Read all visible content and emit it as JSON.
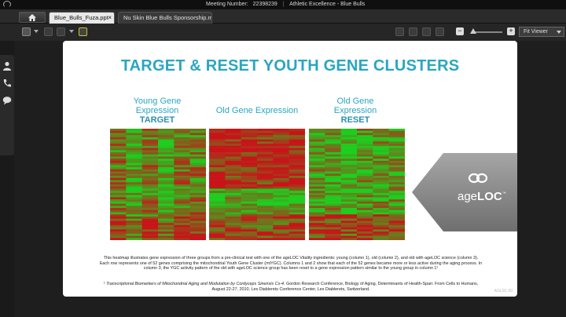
{
  "meeting_bar": {
    "meeting_number_label": "Meeting Number:",
    "meeting_number": "22398239",
    "separator": "|",
    "meeting_title": "Athletic Excellence - Blue Bulls"
  },
  "tabs": [
    {
      "label": "Blue_Bulls_Fuza.ppt",
      "close": "×"
    },
    {
      "label": "Nu Skin Blue Bulls Sponsorship.m",
      "close": ""
    }
  ],
  "toolbar": {
    "zoom_out": "−",
    "zoom_in": "+",
    "fit_view": "Fit Viewer",
    "zoom_level": 0.1
  },
  "slide": {
    "title": "TARGET & RESET YOUTH GENE CLUSTERS",
    "columns": [
      {
        "line1": "Young Gene",
        "line2": "Expression",
        "line3": "TARGET"
      },
      {
        "line1": "Old Gene Expression",
        "line2": "",
        "line3": ""
      },
      {
        "line1": "Old Gene",
        "line2": "Expression",
        "line3": "RESET"
      }
    ],
    "logo_text_a": "age",
    "logo_text_b": "LOC",
    "logo_tm": "™",
    "caption_1": "This heatmap illustrates gene expression of three groups from a pre-clinical test with one of the ageLOC Vitality ingredients: young (column 1), old (column 2), and old with ageLOC science (column 3).",
    "caption_2": "Each row represents one of 52 genes comprising the mitochondrial Youth Gene Cluster (mtYGC). Columns 1 and 2 show that each of the 52 genes became more or less active during the aging process. In",
    "caption_3": "column 3, the YGC activity pattern of the old with ageLOC science group has been reset to a gene expression pattern similar to the young group in column 1¹",
    "footnote_mark": "¹",
    "footnote_title": "Transcriptional Biomarkers of Mitochondrial Aging and Modulation by Cordyceps Sinensis Cs-4.",
    "footnote_1": "Gordon Research Conference, Biology of Aging, Determinants of Health-Span: From Cells to Humans,",
    "footnote_2": "August 22-27, 2010, Les Diablerets Conference Center, Les Diablerets, Switzerland.",
    "watermark": "AGL0C 00"
  },
  "colors": {
    "title": "#2aa6c2",
    "heat_red": "#c8141c",
    "heat_green": "#2ed12e",
    "arrow_gray": "#8c8c8c"
  },
  "icons": {
    "home": "home-icon",
    "user": "user-icon",
    "phone": "phone-icon",
    "chat": "chat-icon"
  }
}
